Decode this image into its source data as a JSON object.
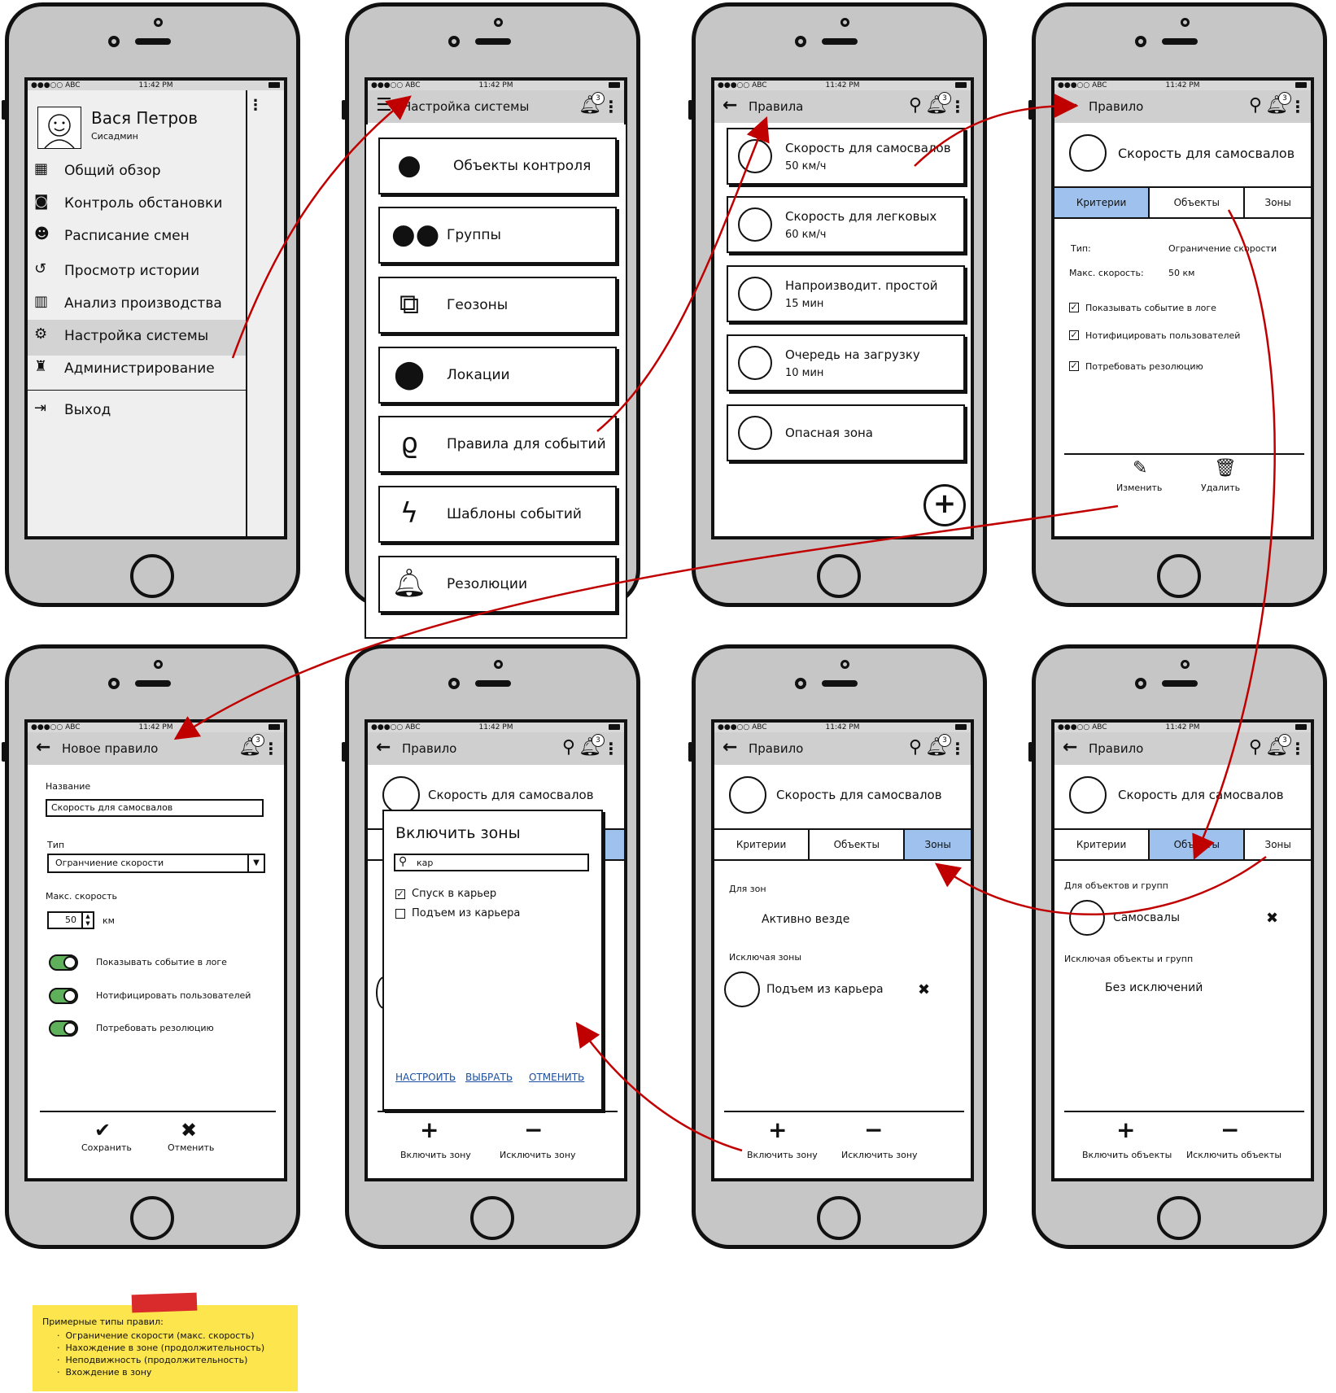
{
  "status": {
    "carrier": "●●●○○ ABC",
    "time": "11:42 PM"
  },
  "badge": "3",
  "p1": {
    "user_name": "Вася Петров",
    "user_role": "Сисадмин",
    "menu": [
      "Общий обзор",
      "Контроль обстановки",
      "Расписание смен",
      "Просмотр истории",
      "Анализ производства",
      "Настройка системы",
      "Администрирование"
    ],
    "logout": "Выход"
  },
  "p2": {
    "title": "Настройка системы",
    "items": [
      "Объекты контроля",
      "Группы",
      "Геозоны",
      "Локации",
      "Правила для событий",
      "Шаблоны событий",
      "Резолюции"
    ]
  },
  "p3": {
    "title": "Правила",
    "rules": [
      {
        "name": "Скорость для самосвалов",
        "value": "50 км/ч"
      },
      {
        "name": "Скорость для легковых",
        "value": "60 км/ч"
      },
      {
        "name": "Напроизводит. простой",
        "value": "15 мин"
      },
      {
        "name": "Очередь на загрузку",
        "value": "10 мин"
      },
      {
        "name": "Опасная зона",
        "value": ""
      }
    ]
  },
  "p4": {
    "title": "Правило",
    "rule_name": "Скорость для самосвалов",
    "tabs": [
      "Критерии",
      "Объекты",
      "Зоны"
    ],
    "type_label": "Тип:",
    "type_value": "Ограничение скорости",
    "speed_label": "Макс. скорость:",
    "speed_value": "50 км",
    "checks": [
      "Показывать событие в логе",
      "Нотифицировать пользователей",
      "Потребовать резолюцию"
    ],
    "edit": "Изменить",
    "delete": "Удалить"
  },
  "p5": {
    "title": "Новое правило",
    "name_label": "Название",
    "name_value": "Скорость для самосвалов",
    "type_label": "Тип",
    "type_value": "Огранчиение скорости",
    "speed_label": "Макс. скорость",
    "speed_value": "50",
    "speed_unit": "км",
    "toggles": [
      "Показывать событие в логе",
      "Нотифицировать пользователей",
      "Потребовать резолюцию"
    ],
    "save": "Сохранить",
    "cancel": "Отменить"
  },
  "p6": {
    "title": "Правило",
    "behind_text": "Скорость для самосвалов",
    "dialog_title": "Включить зоны",
    "search_value": "кар",
    "options": [
      {
        "label": "Спуск в карьер",
        "checked": true
      },
      {
        "label": "Подъем из карьера",
        "checked": false
      }
    ],
    "link_setup": "НАСТРОИТЬ",
    "link_select": "ВЫБРАТЬ",
    "link_cancel": "ОТМЕНИТЬ",
    "include": "Включить зону",
    "exclude": "Исключить зону"
  },
  "p7": {
    "title": "Правило",
    "rule_name": "Скорость для самосвалов",
    "tabs": [
      "Критерии",
      "Объекты",
      "Зоны"
    ],
    "for_zones": "Для зон",
    "active_everywhere": "Активно везде",
    "except_zones": "Исключая зоны",
    "excluded_zone": "Подъем из карьера",
    "include": "Включить зону",
    "exclude": "Исключить зону"
  },
  "p8": {
    "title": "Правило",
    "rule_name": "Скорость для самосвалов",
    "tabs": [
      "Критерии",
      "Объекты",
      "Зоны"
    ],
    "for_objects": "Для объектов и групп",
    "object": "Самосвалы",
    "except_objects": "Исключая объекты и групп",
    "no_exceptions": "Без исключений",
    "include": "Включить объекты",
    "exclude": "Исключить объекты"
  },
  "note": {
    "title": "Примерные типы правил:",
    "items": [
      "Ограничение скорости (макс. скорость)",
      "Нахождение в зоне (продолжительность)",
      "Неподвижность (продолжительность)",
      "Вхождение в зону"
    ]
  },
  "colors": {
    "phone": "#c6c6c6",
    "appbar": "#cfcfcf",
    "tab_active": "#9ec1ee",
    "arrow": "#c00000",
    "note": "#fde54e",
    "tape": "#d92b2b",
    "toggle_on": "#5fb05a"
  }
}
